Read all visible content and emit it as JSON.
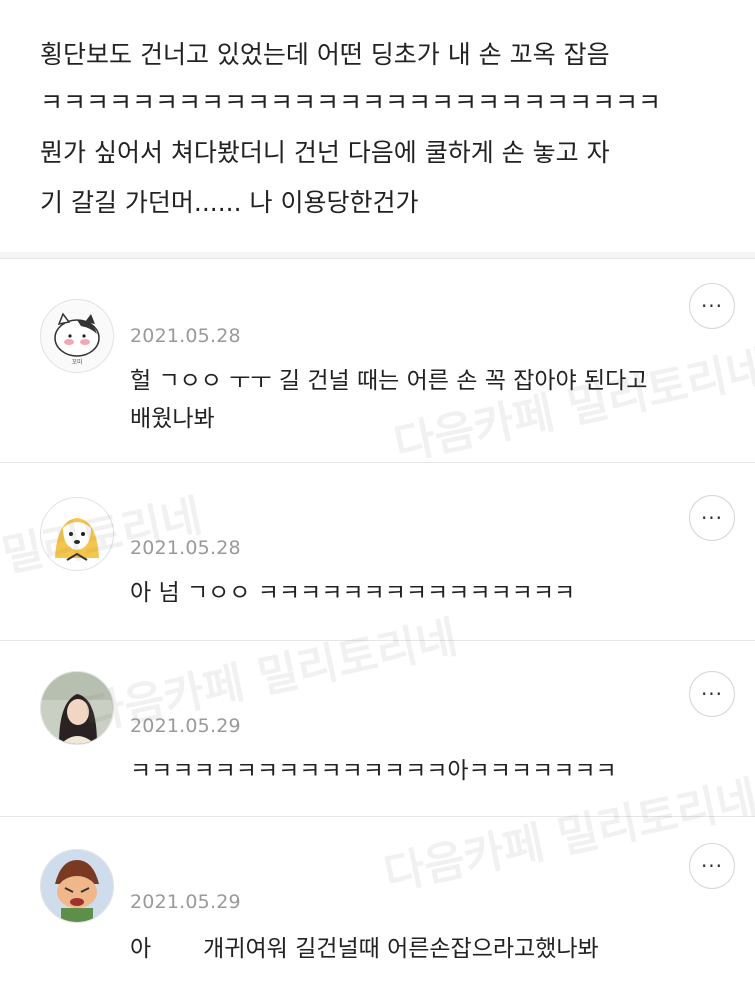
{
  "post": {
    "lines": [
      "횡단보도 건너고 있었는데 어떤 딩초가 내 손 꼬옥 잡음",
      "ㅋㅋㅋㅋㅋㅋㅋㅋㅋㅋㅋㅋㅋㅋㅋㅋㅋㅋㅋㅋㅋㅋㅋㅋㅋㅋㅋ",
      "뭔가 싶어서 쳐다봤더니 건넌 다음에 쿨하게 손 놓고 자",
      "기 갈길 가던머...... 나 이용당한건가"
    ]
  },
  "comments": [
    {
      "date": "2021.05.28",
      "lines": [
        "헐 ㄱㅇㅇ ㅜㅜ 길 건널 때는 어른 손 꼭 잡아야 된다고",
        "배웠나봐"
      ],
      "avatar_icon": "cow-cat-avatar-icon",
      "more_label": "···"
    },
    {
      "date": "2021.05.28",
      "lines": [
        "아 넘 ㄱㅇㅇ ㅋㅋㅋㅋㅋㅋㅋㅋㅋㅋㅋㅋㅋㅋㅋ"
      ],
      "avatar_icon": "dog-avatar-icon",
      "more_label": "···"
    },
    {
      "date": "2021.05.29",
      "lines": [
        "ㅋㅋㅋㅋㅋㅋㅋㅋㅋㅋㅋㅋㅋㅋㅋ아ㅋㅋㅋㅋㅋㅋㅋ"
      ],
      "avatar_icon": "person-photo-avatar-icon",
      "more_label": "···"
    },
    {
      "date": "2021.05.29",
      "lines_prefix": "아",
      "lines_suffix": "개귀여워 길건널때 어른손잡으라고했나봐",
      "avatar_icon": "crying-character-avatar-icon",
      "more_label": "···"
    }
  ],
  "watermarks": [
    "다음카페 밀리토리네",
    "다음카페 밀리토리네",
    "밀리토리네",
    "다음카페 밀리토리네"
  ]
}
